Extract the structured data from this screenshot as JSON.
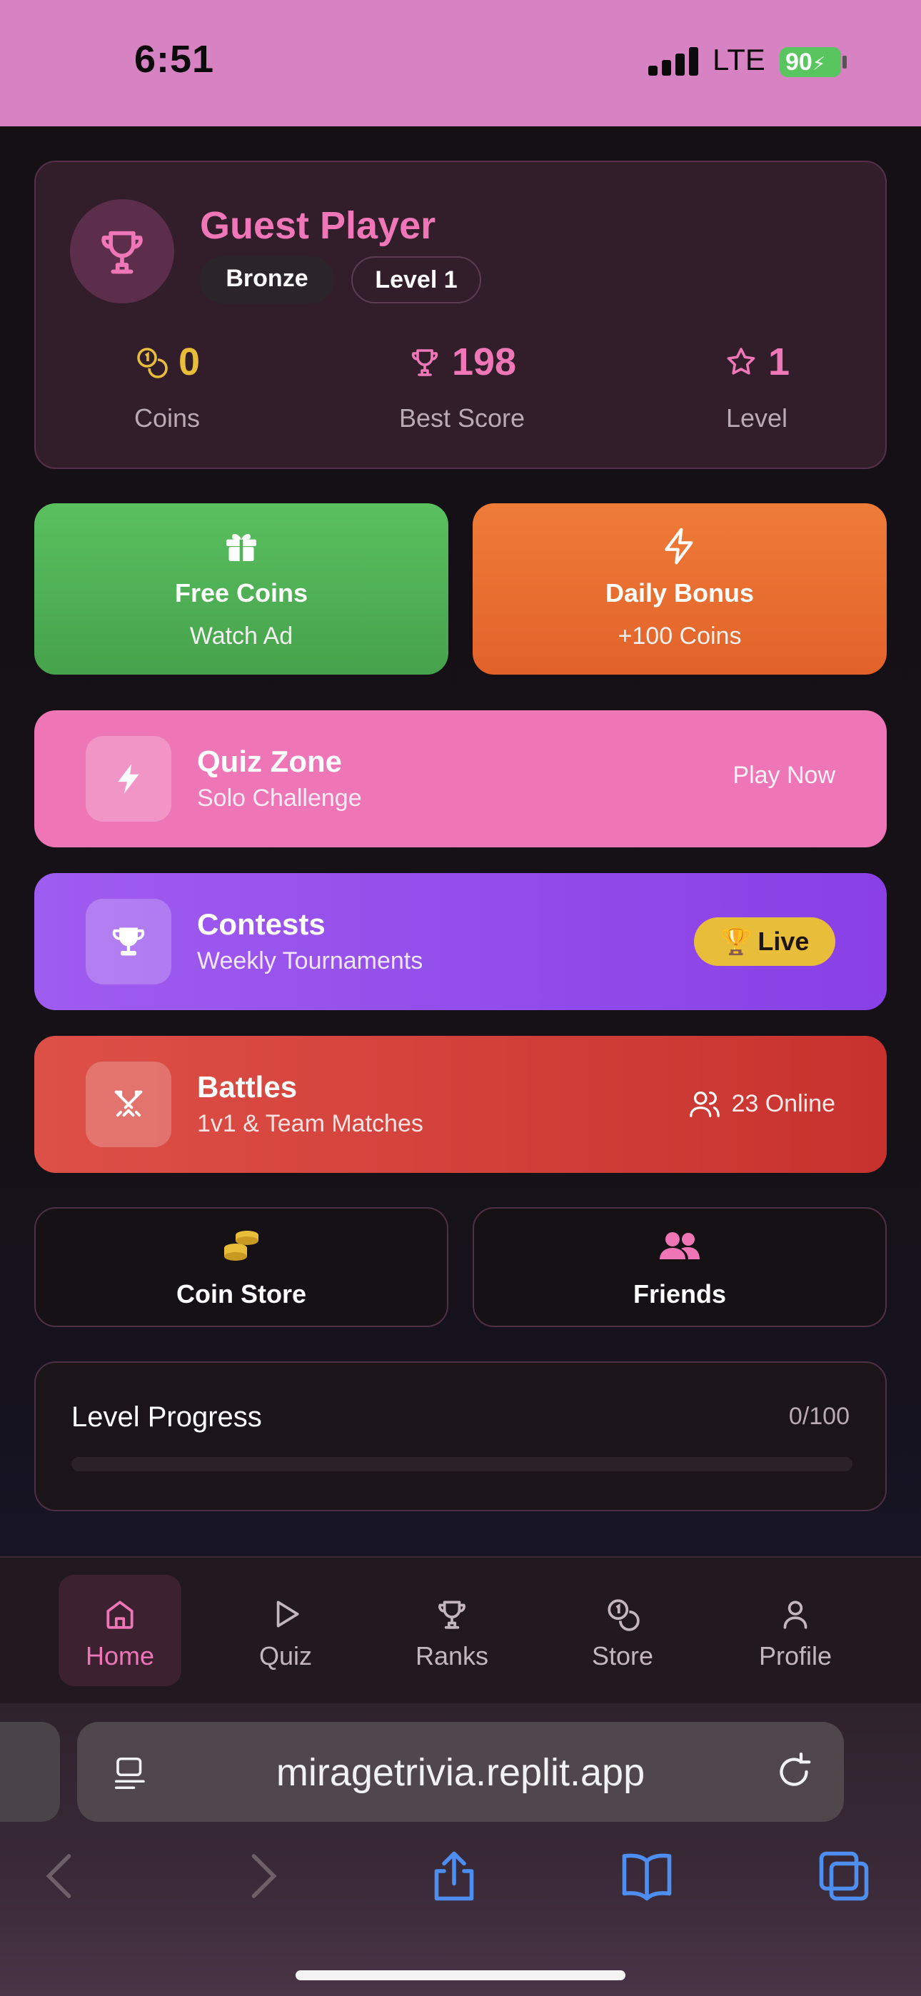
{
  "status_bar": {
    "time": "6:51",
    "network": "LTE",
    "battery": "90"
  },
  "profile": {
    "name": "Guest Player",
    "rank_badge": "Bronze",
    "level_badge": "Level 1",
    "stats": [
      {
        "value": "0",
        "label": "Coins",
        "icon": "coins-icon",
        "color": "#e8bd3a"
      },
      {
        "value": "198",
        "label": "Best Score",
        "icon": "trophy-icon",
        "color": "#ef77b8"
      },
      {
        "value": "1",
        "label": "Level",
        "icon": "star-icon",
        "color": "#ef77b8"
      }
    ]
  },
  "actions": {
    "free_coins": {
      "title": "Free Coins",
      "subtitle": "Watch Ad",
      "icon": "gift-icon"
    },
    "daily_bonus": {
      "title": "Daily Bonus",
      "subtitle": "+100 Coins",
      "icon": "lightning-icon"
    }
  },
  "modes": {
    "quiz": {
      "title": "Quiz Zone",
      "subtitle": "Solo Challenge",
      "right": "Play Now",
      "icon": "bolt-icon"
    },
    "contests": {
      "title": "Contests",
      "subtitle": "Weekly Tournaments",
      "badge": "Live",
      "badge_emoji": "🏆",
      "icon": "trophy-icon"
    },
    "battles": {
      "title": "Battles",
      "subtitle": "1v1 & Team Matches",
      "right": "23 Online",
      "icon": "swords-icon"
    }
  },
  "utilities": {
    "coin_store": "Coin Store",
    "friends": "Friends"
  },
  "progress": {
    "title": "Level Progress",
    "count": "0/100",
    "fraction": 0
  },
  "tabs": [
    {
      "label": "Home",
      "icon": "home-icon",
      "active": true
    },
    {
      "label": "Quiz",
      "icon": "play-icon",
      "active": false
    },
    {
      "label": "Ranks",
      "icon": "trophy-icon",
      "active": false
    },
    {
      "label": "Store",
      "icon": "coins-icon",
      "active": false
    },
    {
      "label": "Profile",
      "icon": "user-icon",
      "active": false
    }
  ],
  "browser": {
    "url": "miragetrivia.replit.app"
  },
  "colors": {
    "accent_pink": "#ee76b6",
    "gold": "#e8bd3a",
    "green": "#5ac05f",
    "orange": "#ef7c38",
    "purple": "#9f5cf0",
    "red": "#dd5048",
    "status_bar": "#d782c3"
  }
}
